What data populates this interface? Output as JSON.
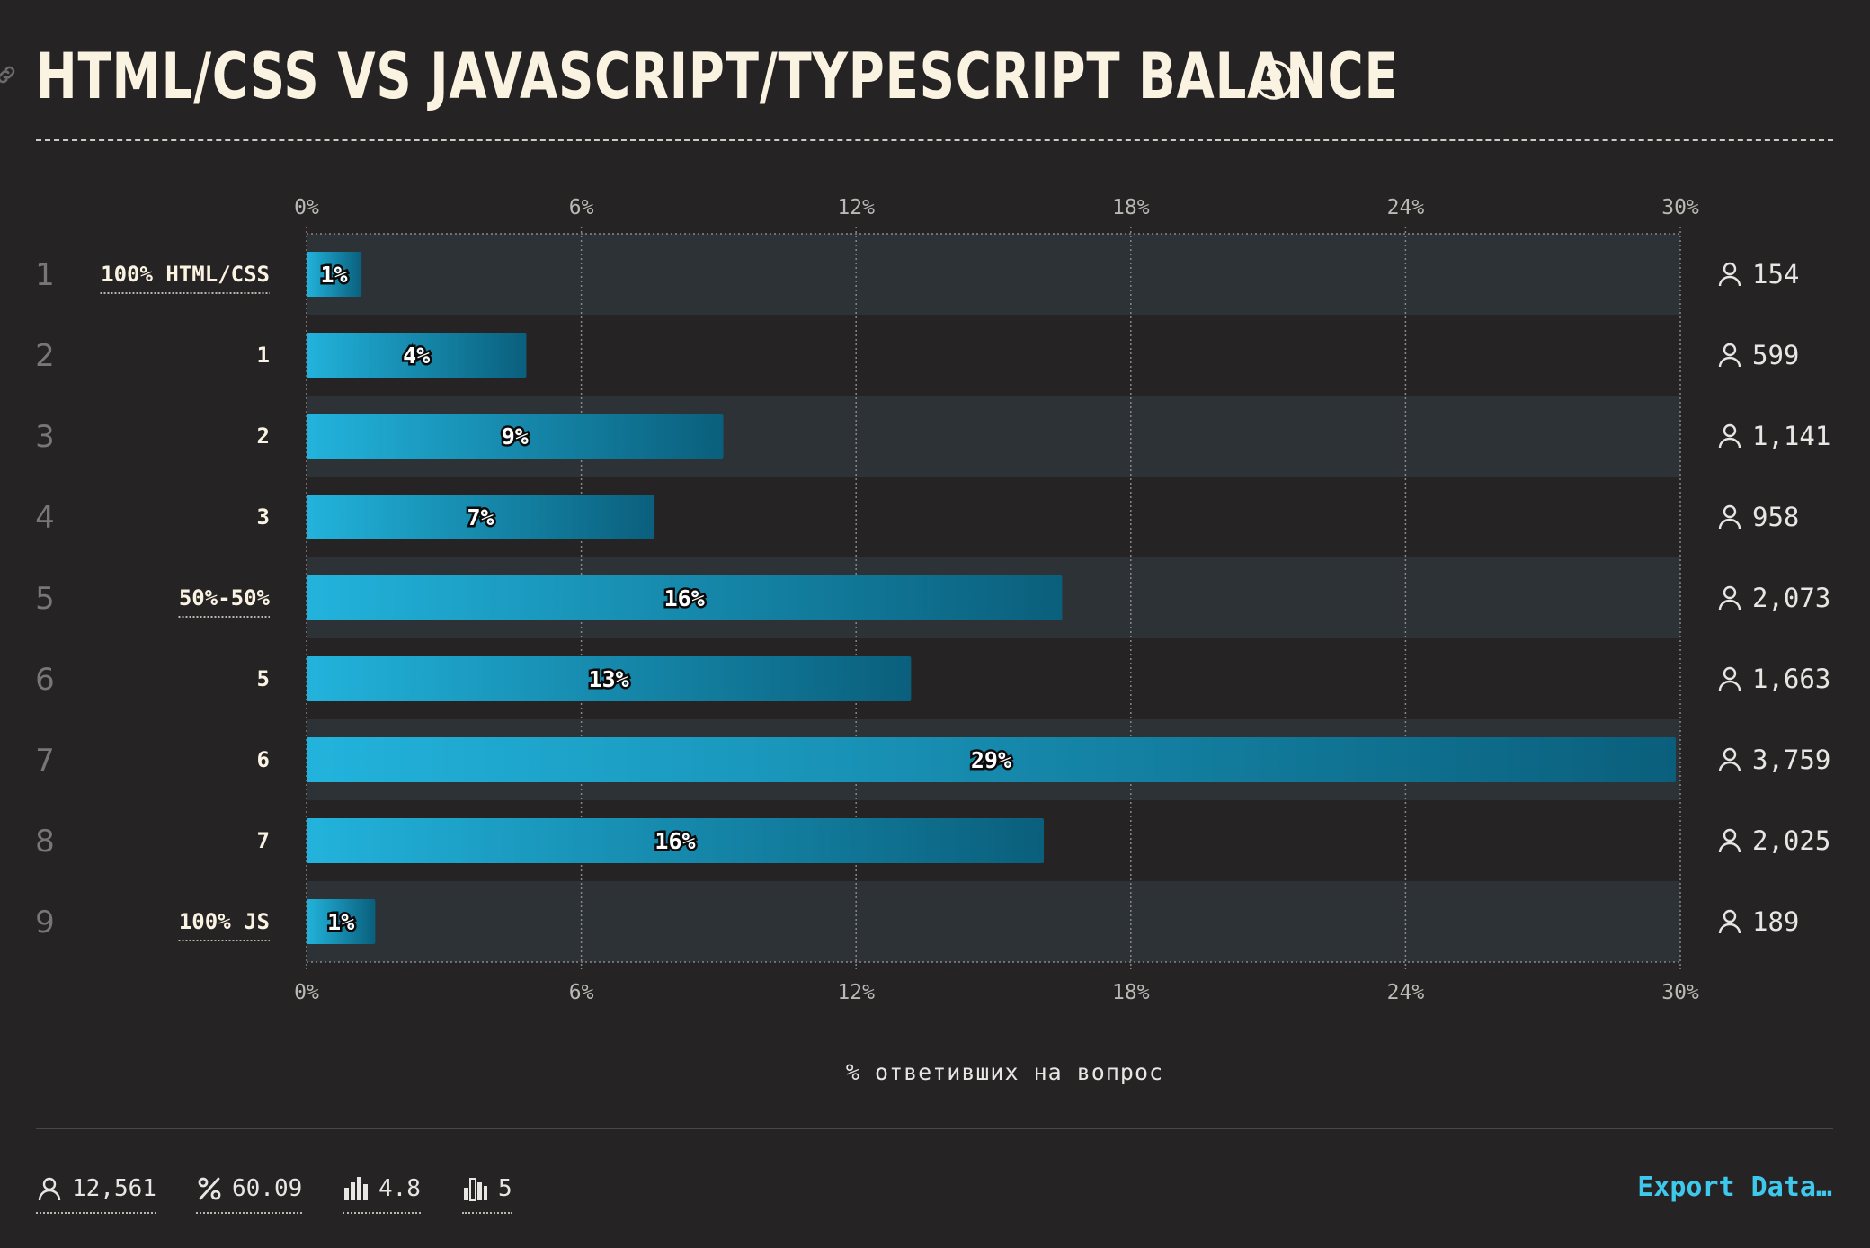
{
  "header": {
    "title": "HTML/CSS VS JAVASCRIPT/TYPESCRIPT BALANCE"
  },
  "chart_data": {
    "type": "bar",
    "orientation": "horizontal",
    "title": "HTML/CSS VS JAVASCRIPT/TYPESCRIPT BALANCE",
    "row_numbers": [
      "1",
      "2",
      "3",
      "4",
      "5",
      "6",
      "7",
      "8",
      "9"
    ],
    "categories": [
      "100% HTML/CSS",
      "1",
      "2",
      "3",
      "50%-50%",
      "5",
      "6",
      "7",
      "100% JS"
    ],
    "underlined_categories": [
      "100% HTML/CSS",
      "50%-50%",
      "100% JS"
    ],
    "values": [
      1.2,
      4.8,
      9.1,
      7.6,
      16.5,
      13.2,
      29.9,
      16.1,
      1.5
    ],
    "value_labels": [
      "1%",
      "4%",
      "9%",
      "7%",
      "16%",
      "13%",
      "29%",
      "16%",
      "1%"
    ],
    "counts": [
      "154",
      "599",
      "1,141",
      "958",
      "2,073",
      "1,663",
      "3,759",
      "2,025",
      "189"
    ],
    "xlabel": "% ответивших на вопрос",
    "xlim": [
      0,
      30
    ],
    "xticks": [
      "0%",
      "6%",
      "12%",
      "18%",
      "24%",
      "30%"
    ],
    "grid": true,
    "colors": {
      "bar_start": "#22b3dc",
      "bar_end": "#0a5f7c",
      "band": "#2d3236"
    }
  },
  "footer": {
    "stats": [
      {
        "icon": "user-icon",
        "value": "12,561"
      },
      {
        "icon": "percent-icon",
        "value": "60.09"
      },
      {
        "icon": "bar-chart-icon",
        "value": "4.8"
      },
      {
        "icon": "bar-chart-outline-icon",
        "value": "5"
      }
    ],
    "export_label": "Export Data…"
  }
}
